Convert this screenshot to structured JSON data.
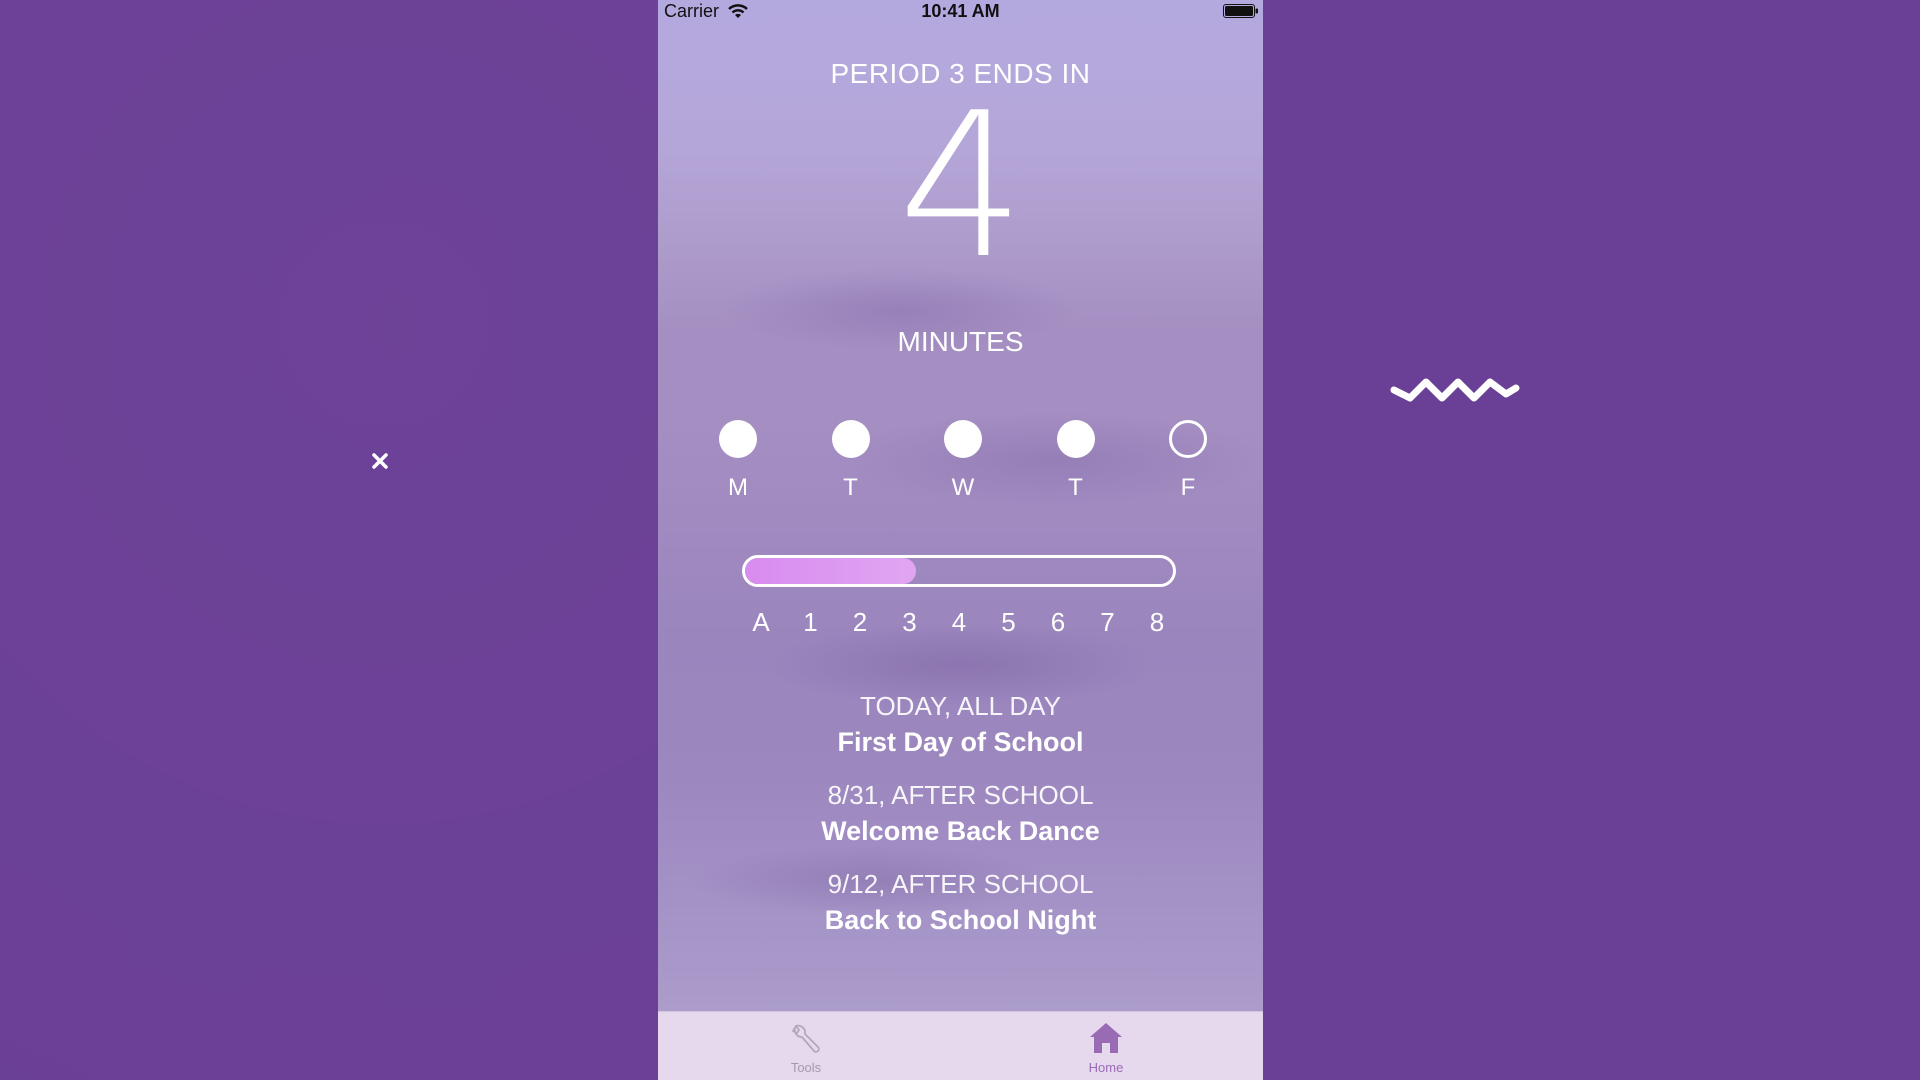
{
  "status_bar": {
    "carrier": "Carrier",
    "time": "10:41 AM"
  },
  "countdown": {
    "title": "PERIOD 3 ENDS IN",
    "value": "4",
    "unit": "MINUTES"
  },
  "week": {
    "days": [
      {
        "label": "M",
        "done": true
      },
      {
        "label": "T",
        "done": true
      },
      {
        "label": "W",
        "done": true
      },
      {
        "label": "T",
        "done": true
      },
      {
        "label": "F",
        "done": false
      }
    ]
  },
  "schedule_progress": {
    "fraction": 0.4,
    "periods": [
      "A",
      "1",
      "2",
      "3",
      "4",
      "5",
      "6",
      "7",
      "8"
    ]
  },
  "events": [
    {
      "when": "TODAY, ALL DAY",
      "name": "First Day of School"
    },
    {
      "when": "8/31, AFTER SCHOOL",
      "name": "Welcome Back Dance"
    },
    {
      "when": "9/12, AFTER SCHOOL",
      "name": "Back to School Night"
    }
  ],
  "tab_bar": {
    "tools_label": "Tools",
    "home_label": "Home",
    "active": "home"
  },
  "colors": {
    "backdrop": "#6a3f96",
    "progress_fill": "#d98bef",
    "tab_active": "#9a6bb5",
    "tab_inactive": "#a698ab"
  }
}
